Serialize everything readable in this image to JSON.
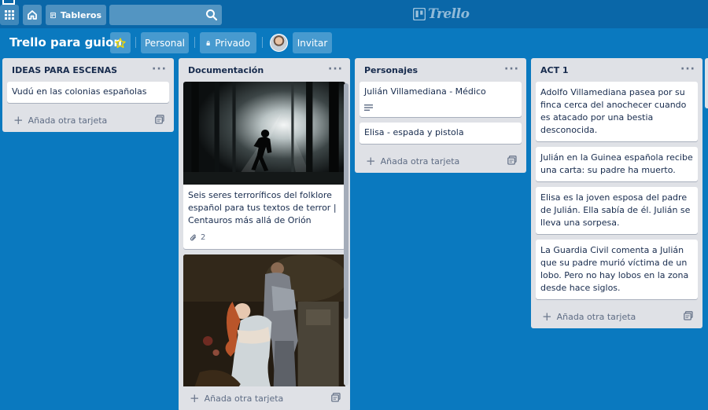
{
  "topbar": {
    "boards_label": "Tableros",
    "search_value": "",
    "logo_text": "Trello",
    "icons": [
      "apps-icon",
      "home-icon",
      "boards-icon",
      "search-icon"
    ]
  },
  "board": {
    "title": "Trello para guion",
    "personal_label": "Personal",
    "private_label": "Privado",
    "invite_label": "Invitar",
    "star_color": "#f2d600"
  },
  "colors": {
    "background": "#0a79bf",
    "header": "#0a67a8",
    "list": "#dfe1e6",
    "card": "#ffffff",
    "text": "#172b4d"
  },
  "lists": [
    {
      "title": "IDEAS PARA ESCENAS",
      "cards": [
        {
          "text": "Vudú en las colonias españolas"
        }
      ],
      "add_label": "Añada otra tarjeta"
    },
    {
      "title": "Documentación",
      "cards": [
        {
          "text": "Seis seres terroríficos del folklore español para tus textos de terror | Centauros más allá de Orión",
          "attachments": "2"
        },
        {
          "text": ""
        }
      ],
      "add_label": "Añada otra tarjeta"
    },
    {
      "title": "Personajes",
      "cards": [
        {
          "text": "Julián Villamediana - Médico",
          "has_description": true
        },
        {
          "text": "Elisa - espada y pistola"
        }
      ],
      "add_label": "Añada otra tarjeta"
    },
    {
      "title": "ACT 1",
      "cards": [
        {
          "text": "Adolfo Villamediana pasea por su finca cerca del anochecer cuando es atacado por una bestia desconocida."
        },
        {
          "text": "Julián en la Guinea española recibe una carta: su padre ha muerto."
        },
        {
          "text": "Elisa es la joven esposa del padre de Julián. Ella sabía de él. Julián se lleva una sorpesa."
        },
        {
          "text": "La Guardia Civil comenta a Julián que su padre murió víctima de un lobo. Pero no hay lobos en la zona desde hace siglos."
        }
      ],
      "add_label": "Añada otra tarjeta"
    }
  ]
}
